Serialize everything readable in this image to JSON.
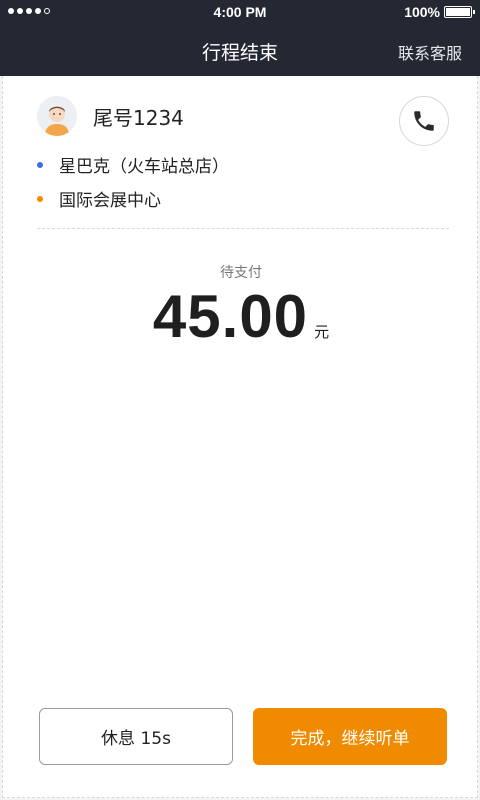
{
  "status_bar": {
    "time": "4:00 PM",
    "battery": "100%",
    "signal_bars_filled": 4,
    "signal_bars_total": 5
  },
  "nav": {
    "title": "行程结束",
    "action": "联系客服"
  },
  "passenger": {
    "label": "尾号1234",
    "avatar_icon": "avatar-icon",
    "call_icon": "phone-icon"
  },
  "route": {
    "start": "星巴克（火车站总店）",
    "end": "国际会展中心",
    "start_color": "#3d6ee8",
    "end_color": "#f08b00"
  },
  "payment": {
    "label": "待支付",
    "amount": "45.00",
    "unit": "元"
  },
  "actions": {
    "rest": "休息 15s",
    "finish": "完成，继续听单",
    "finish_color": "#f08b00"
  },
  "colors": {
    "header_bg": "#242833"
  }
}
